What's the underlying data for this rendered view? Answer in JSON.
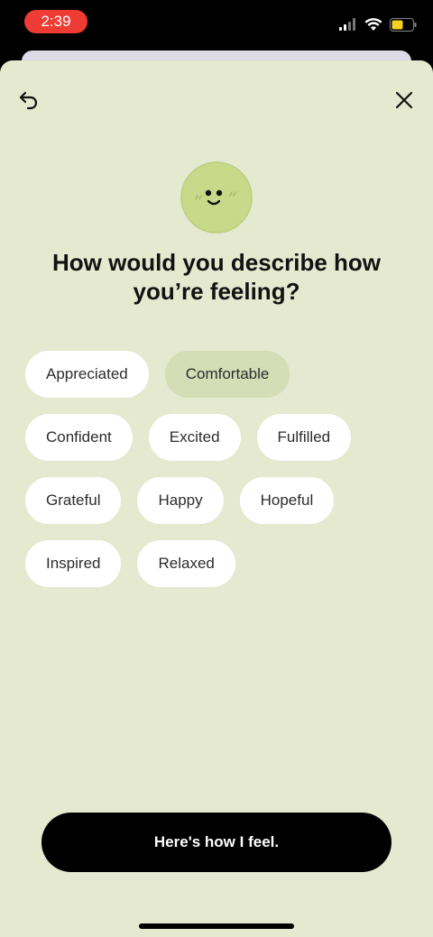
{
  "status_bar": {
    "time": "2:39"
  },
  "title": "How would you describe how you’re feeling?",
  "feelings": {
    "rows": [
      [
        {
          "label": "Appreciated",
          "selected": false
        },
        {
          "label": "Comfortable",
          "selected": true
        }
      ],
      [
        {
          "label": "Confident",
          "selected": false
        },
        {
          "label": "Excited",
          "selected": false
        },
        {
          "label": "Fulfilled",
          "selected": false
        }
      ],
      [
        {
          "label": "Grateful",
          "selected": false
        },
        {
          "label": "Happy",
          "selected": false
        },
        {
          "label": "Hopeful",
          "selected": false
        }
      ],
      [
        {
          "label": "Inspired",
          "selected": false
        },
        {
          "label": "Relaxed",
          "selected": false
        }
      ]
    ]
  },
  "cta": {
    "label": "Here's how I feel."
  },
  "colors": {
    "sheet_bg": "#e4e9cf",
    "chip_bg": "#ffffff",
    "chip_selected_bg": "#d5ddb6",
    "face": "#c8d98a",
    "time_pill": "#ee3b34",
    "battery": "#f5d020"
  },
  "icons": {
    "back": "undo-arrow-icon",
    "close": "close-icon",
    "face": "smiley-face-icon",
    "signal": "cellular-signal-icon",
    "wifi": "wifi-icon",
    "battery": "battery-icon"
  }
}
